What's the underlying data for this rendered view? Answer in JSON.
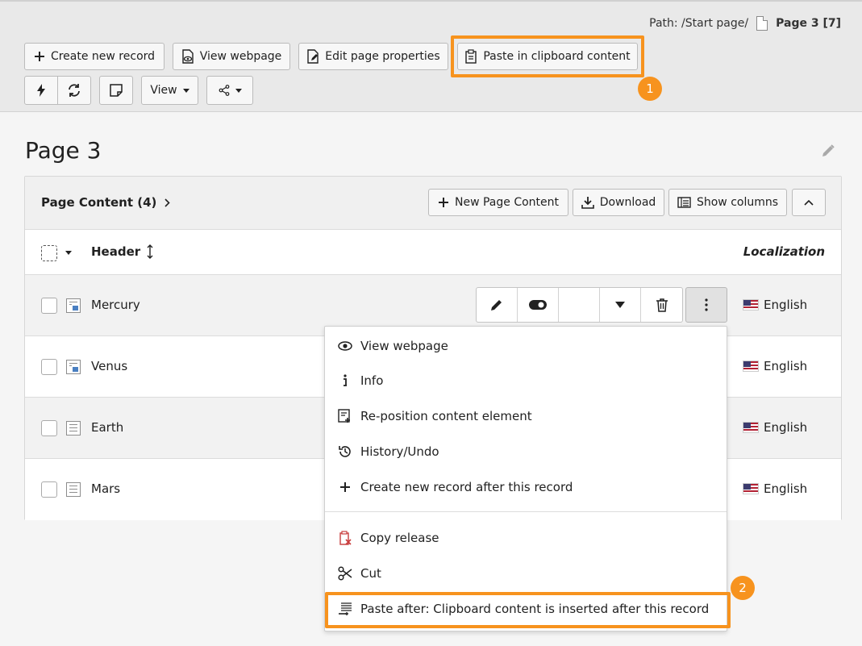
{
  "path": {
    "prefix": "Path: /Start page/",
    "page": "Page 3 [7]"
  },
  "toolbar": {
    "create_record": "Create new record",
    "view_webpage": "View webpage",
    "edit_page_properties": "Edit page properties",
    "paste_clipboard": "Paste in clipboard content",
    "view": "View"
  },
  "callouts": {
    "one": "1",
    "two": "2"
  },
  "page_title": "Page 3",
  "panel": {
    "title": "Page Content (4)",
    "new_content": "New Page Content",
    "download": "Download",
    "show_columns": "Show columns",
    "header_col": "Header",
    "localization_col": "Localization"
  },
  "rows": [
    {
      "header": "Mercury",
      "language": "English"
    },
    {
      "header": "Venus",
      "language": "English"
    },
    {
      "header": "Earth",
      "language": "English"
    },
    {
      "header": "Mars",
      "language": "English"
    }
  ],
  "menu": {
    "view_webpage": "View webpage",
    "info": "Info",
    "reposition": "Re-position content element",
    "history": "History/Undo",
    "create_after": "Create new record after this record",
    "copy_release": "Copy release",
    "cut": "Cut",
    "paste_after": "Paste after: Clipboard content is inserted after this record"
  },
  "colors": {
    "highlight": "#f7931e",
    "copy_release_icon": "#c83c3c"
  }
}
